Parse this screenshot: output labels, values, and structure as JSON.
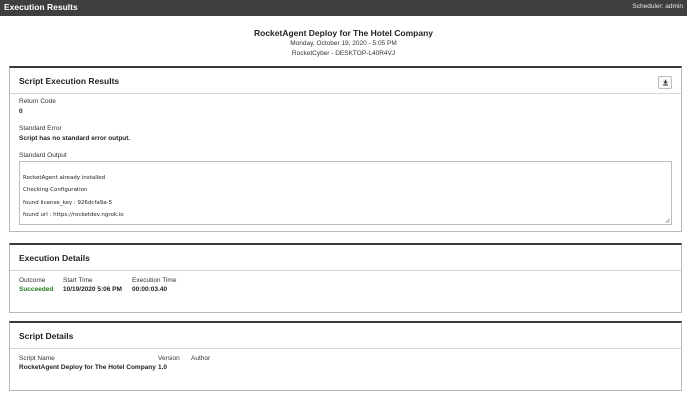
{
  "topbar": {
    "title": "Execution Results",
    "user": "Scheduler: admin"
  },
  "header": {
    "title": "RocketAgent Deploy for The Hotel Company",
    "date": "Monday, October 19, 2020 - 5:05 PM",
    "device": "RocketCyber - DESKTOP-L40R4VJ"
  },
  "script_results": {
    "title": "Script Execution Results",
    "download_icon": "download-icon",
    "return_code_label": "Return Code",
    "return_code_value": "0",
    "stderr_label": "Standard Error",
    "stderr_value": "Script has no standard error output.",
    "stdout_label": "Standard Output",
    "stdout_lines": [
      "RocketAgent already installed",
      "Checking Configuration",
      "found license_key : 926dcfa9a-5",
      "found url : https://rocketdev.ngrok.io"
    ]
  },
  "execution_details": {
    "title": "Execution Details",
    "outcome_label": "Outcome",
    "outcome_value": "Succeeded",
    "start_label": "Start Time",
    "start_value": "10/19/2020 5:06 PM",
    "exec_label": "Execution Time",
    "exec_value": "00:00:03.40"
  },
  "script_details": {
    "title": "Script Details",
    "name_label": "Script Name",
    "name_value": "RocketAgent Deploy for The Hotel Company",
    "version_label": "Version",
    "version_value": "1.0",
    "author_label": "Author",
    "author_value": ""
  },
  "colors": {
    "topbar": "#3f3f3f",
    "panel_border_top": "#3a3a3a",
    "success": "#1e7b1e"
  }
}
